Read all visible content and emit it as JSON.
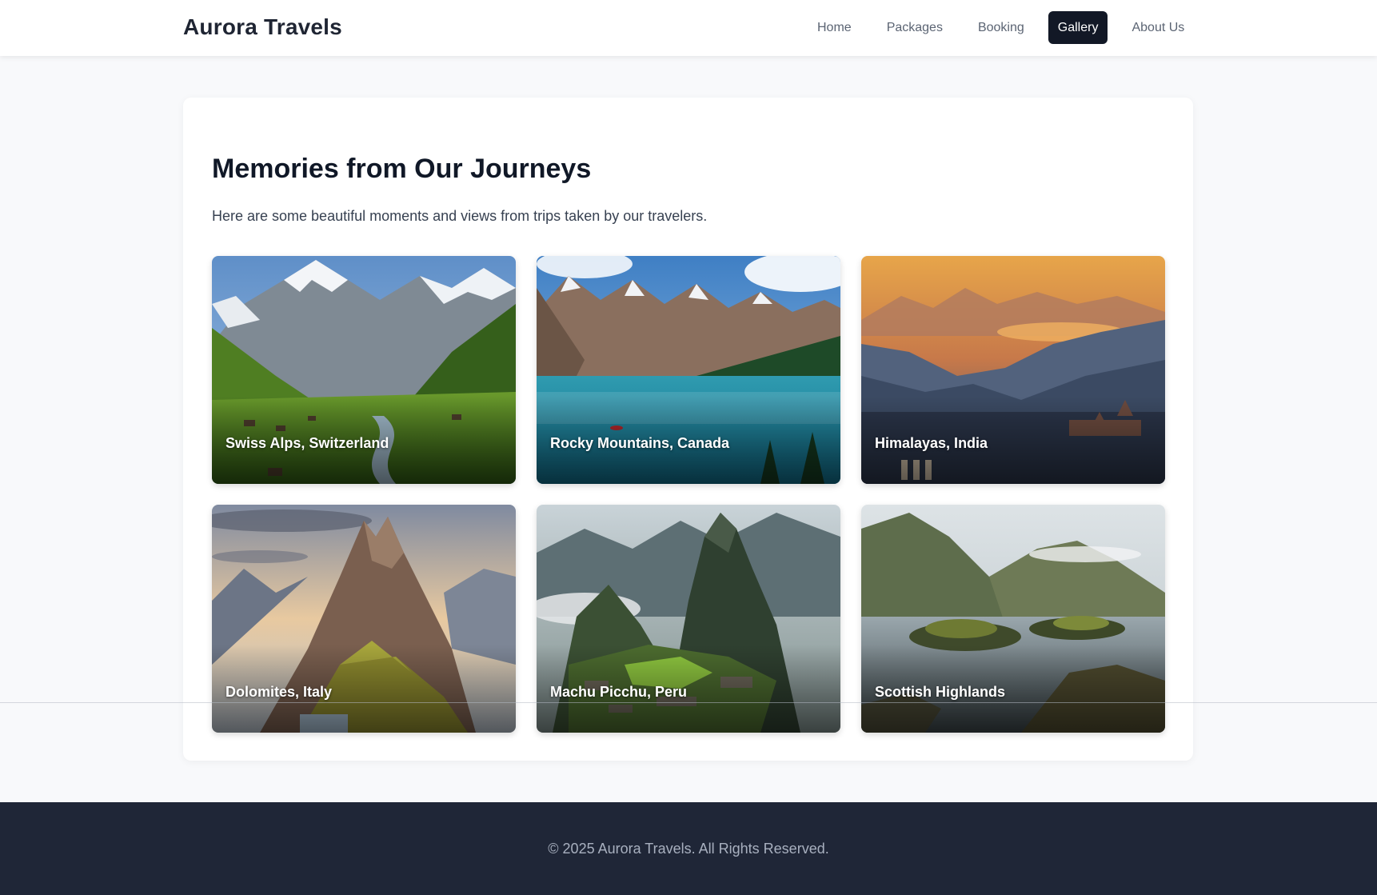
{
  "header": {
    "brand": "Aurora Travels",
    "nav": [
      {
        "label": "Home",
        "active": false
      },
      {
        "label": "Packages",
        "active": false
      },
      {
        "label": "Booking",
        "active": false
      },
      {
        "label": "Gallery",
        "active": true
      },
      {
        "label": "About Us",
        "active": false
      }
    ]
  },
  "gallery": {
    "title": "Memories from Our Journeys",
    "intro": "Here are some beautiful moments and views from trips taken by our travelers.",
    "items": [
      {
        "caption": "Swiss Alps, Switzerland"
      },
      {
        "caption": "Rocky Mountains, Canada"
      },
      {
        "caption": "Himalayas, India"
      },
      {
        "caption": "Dolomites, Italy"
      },
      {
        "caption": "Machu Picchu, Peru"
      },
      {
        "caption": "Scottish Highlands"
      }
    ]
  },
  "footer": {
    "copyright": "© 2025 Aurora Travels. All Rights Reserved."
  },
  "colors": {
    "nav_active_bg": "#121826",
    "footer_bg": "#1f2637",
    "page_bg": "#f8f9fb"
  }
}
